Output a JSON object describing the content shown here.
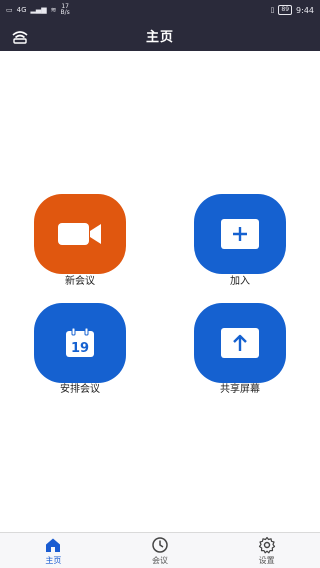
{
  "status_bar": {
    "network_label": "4G",
    "speed_value": "17",
    "speed_unit": "B/s",
    "battery_level": "89",
    "time": "9:44"
  },
  "app_bar": {
    "title": "主页"
  },
  "actions": [
    {
      "label": "新会议",
      "icon": "video-camera-icon",
      "color": "#e0570f"
    },
    {
      "label": "加入",
      "icon": "plus-icon",
      "color": "#1561d0"
    },
    {
      "label": "安排会议",
      "icon": "calendar-icon",
      "color": "#1561d0",
      "icon_text": "19"
    },
    {
      "label": "共享屏幕",
      "icon": "share-screen-icon",
      "color": "#1561d0"
    }
  ],
  "tabs": [
    {
      "label": "主页",
      "icon": "home-icon",
      "active": true
    },
    {
      "label": "会议",
      "icon": "clock-icon",
      "active": false
    },
    {
      "label": "设置",
      "icon": "gear-icon",
      "active": false
    }
  ],
  "colors": {
    "header_bg": "#2a2a3a",
    "accent_blue": "#1561d0",
    "accent_orange": "#e0570f"
  }
}
